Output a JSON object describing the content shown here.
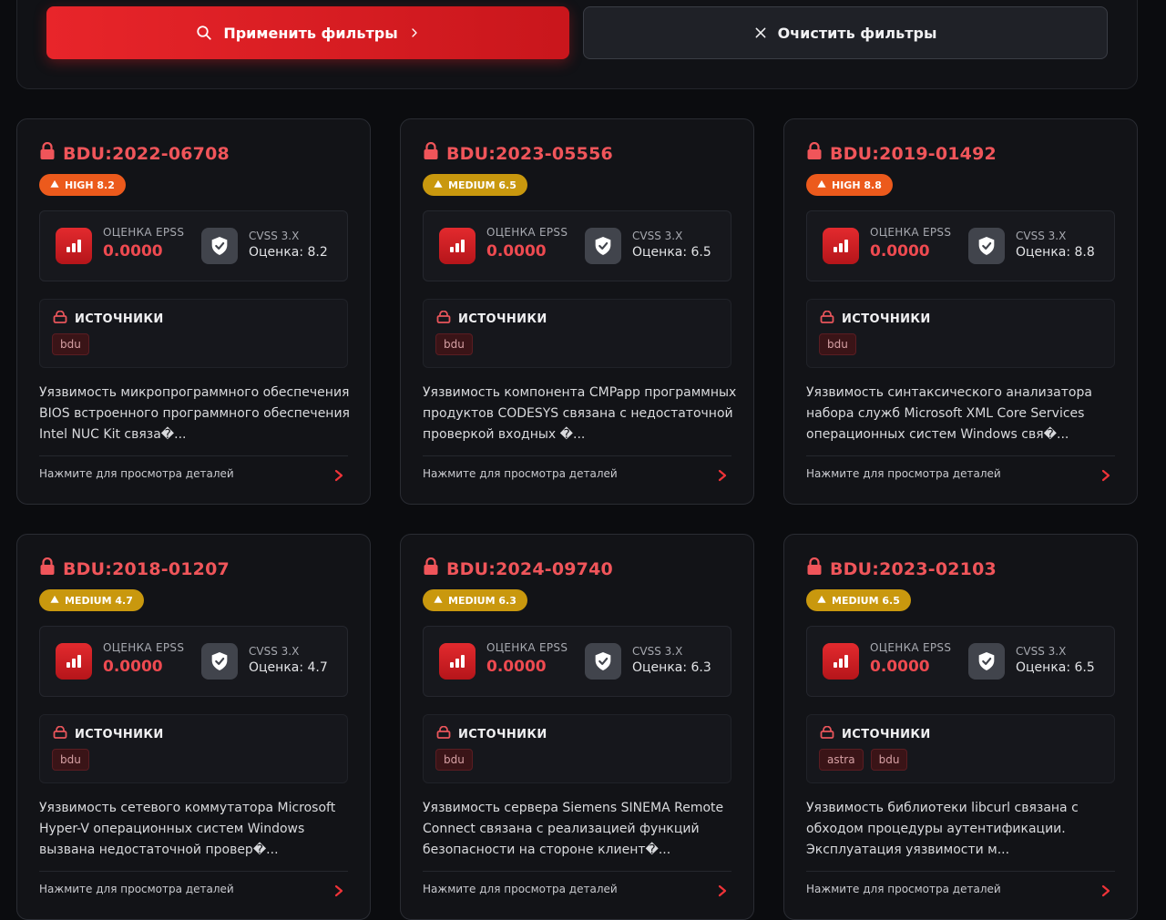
{
  "filters": {
    "apply_label": "Применить фильтры",
    "clear_label": "Очистить фильтры"
  },
  "labels": {
    "epss": "ОЦЕНКА EPSS",
    "cvss": "CVSS 3.X",
    "sources": "ИСТОЧНИКИ",
    "details_hint": "Нажмите для просмотра деталей"
  },
  "colors": {
    "accent_red": "#e8252a",
    "high": "#ec5a1c",
    "medium": "#c9980e",
    "background": "#0b0c0f"
  },
  "cards": [
    {
      "id": "BDU:2022-06708",
      "severity": "HIGH 8.2",
      "severity_level": "high",
      "epss": "0.0000",
      "cvss": "Оценка: 8.2",
      "sources": [
        "bdu"
      ],
      "description": "Уязвимость микропрограммного обеспечения BIOS встроенного программного обеспечения Intel NUC Kit связа�..."
    },
    {
      "id": "BDU:2023-05556",
      "severity": "MEDIUM 6.5",
      "severity_level": "medium",
      "epss": "0.0000",
      "cvss": "Оценка: 6.5",
      "sources": [
        "bdu"
      ],
      "description": "Уязвимость компонента CMPapp программных продуктов CODESYS связана с недостаточной проверкой входных �..."
    },
    {
      "id": "BDU:2019-01492",
      "severity": "HIGH 8.8",
      "severity_level": "high",
      "epss": "0.0000",
      "cvss": "Оценка: 8.8",
      "sources": [
        "bdu"
      ],
      "description": "Уязвимость синтаксического анализатора набора служб Microsoft XML Core Services операционных систем Windows свя�..."
    },
    {
      "id": "BDU:2018-01207",
      "severity": "MEDIUM 4.7",
      "severity_level": "medium",
      "epss": "0.0000",
      "cvss": "Оценка: 4.7",
      "sources": [
        "bdu"
      ],
      "description": "Уязвимость сетевого коммутатора Microsoft Hyper-V операционных систем Windows вызвана недостаточной провер�..."
    },
    {
      "id": "BDU:2024-09740",
      "severity": "MEDIUM 6.3",
      "severity_level": "medium",
      "epss": "0.0000",
      "cvss": "Оценка: 6.3",
      "sources": [
        "bdu"
      ],
      "description": "Уязвимость сервера Siemens SINEMA Remote Connect связана с реализацией функций безопасности на стороне клиент�..."
    },
    {
      "id": "BDU:2023-02103",
      "severity": "MEDIUM 6.5",
      "severity_level": "medium",
      "epss": "0.0000",
      "cvss": "Оценка: 6.5",
      "sources": [
        "astra",
        "bdu"
      ],
      "description": "Уязвимость библиотеки libcurl связана с обходом процедуры аутентификации. Эксплуатация уязвимости м..."
    }
  ]
}
